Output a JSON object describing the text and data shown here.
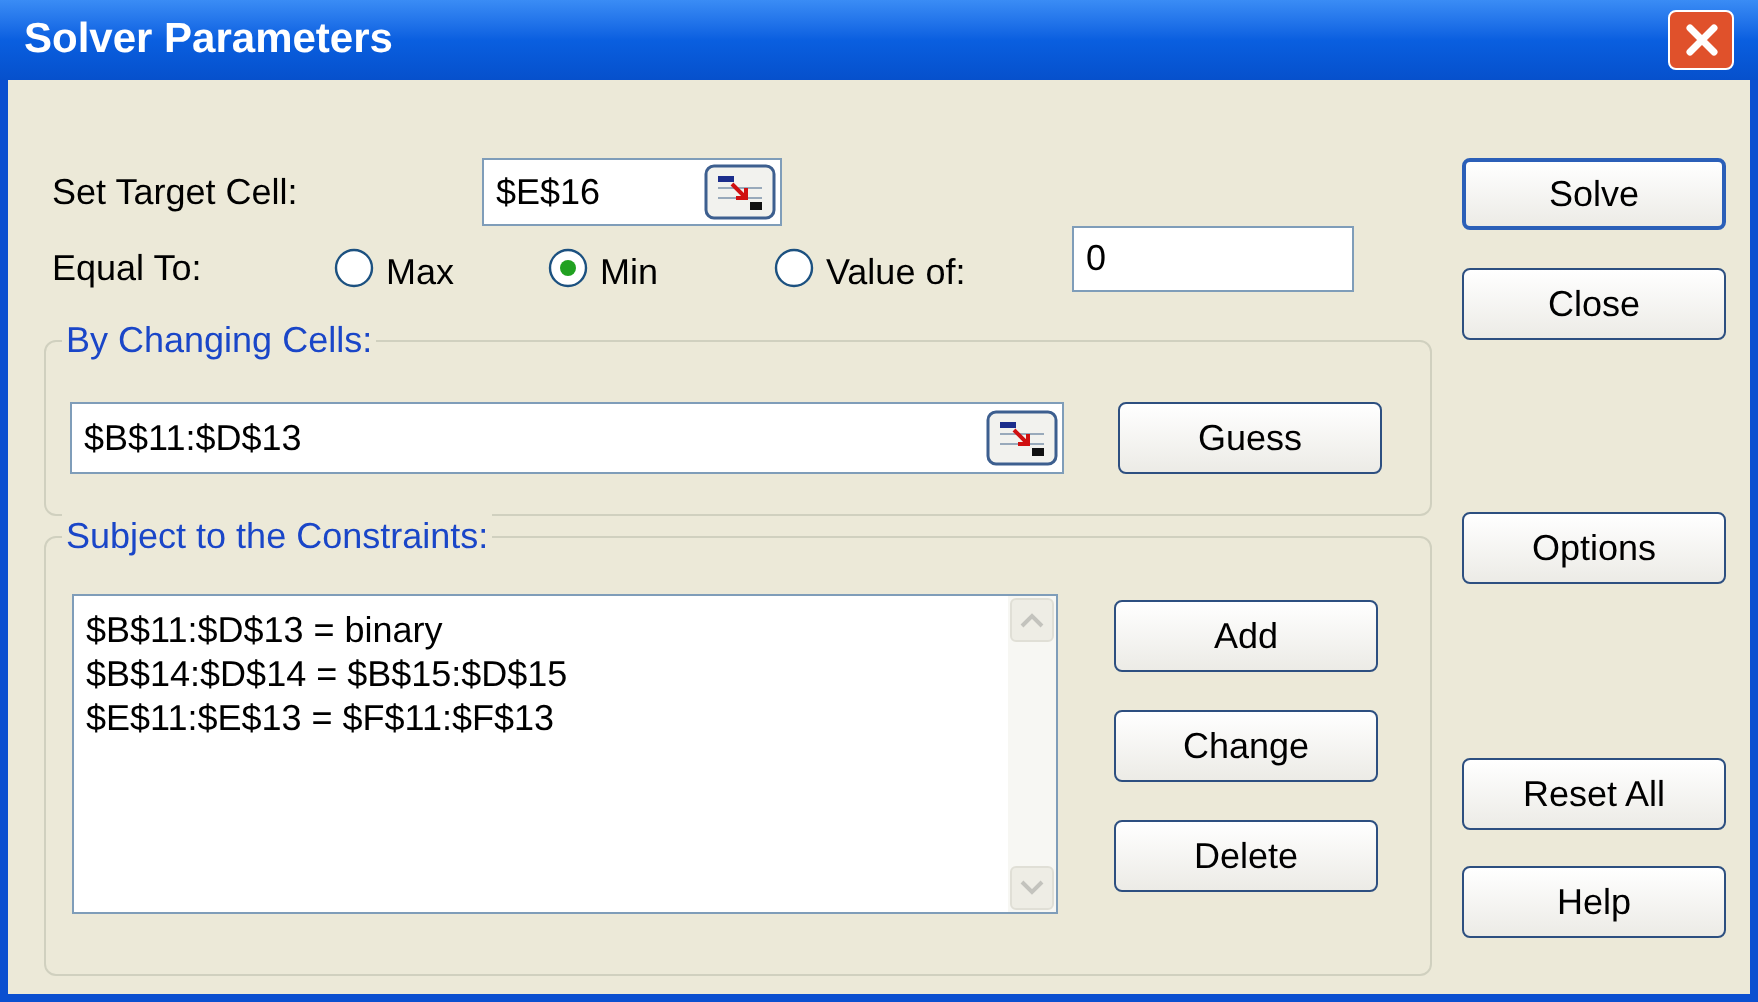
{
  "window": {
    "title": "Solver Parameters"
  },
  "target_cell": {
    "label": "Set Target Cell:",
    "value": "$E$16"
  },
  "equal_to": {
    "label": "Equal To:",
    "options": [
      {
        "label": "Max",
        "selected": false
      },
      {
        "label": "Min",
        "selected": true
      },
      {
        "label": "Value of:",
        "selected": false
      }
    ],
    "value": "0"
  },
  "changing_cells": {
    "label": "By Changing Cells:",
    "value": "$B$11:$D$13",
    "button": {
      "label": "Guess"
    }
  },
  "constraints": {
    "label": "Subject to the Constraints:",
    "items": [
      "$B$11:$D$13 = binary",
      "$B$14:$D$14 = $B$15:$D$15",
      "$E$11:$E$13 = $F$11:$F$13"
    ],
    "buttons": [
      {
        "label": "Add"
      },
      {
        "label": "Change"
      },
      {
        "label": "Delete"
      }
    ]
  },
  "side_buttons": [
    {
      "label": "Solve",
      "default": true
    },
    {
      "label": "Close",
      "default": false
    },
    {
      "label": "Options",
      "default": false
    },
    {
      "label": "Reset All",
      "default": false
    },
    {
      "label": "Help",
      "default": false
    }
  ]
}
